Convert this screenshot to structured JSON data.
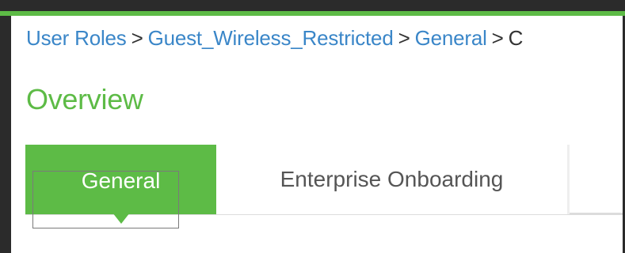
{
  "breadcrumb": {
    "items": [
      {
        "label": "User Roles"
      },
      {
        "label": "Guest_Wireless_Restricted"
      },
      {
        "label": "General"
      }
    ],
    "separator": ">",
    "current_fragment": "C"
  },
  "page": {
    "title": "Overview"
  },
  "tabs": [
    {
      "label": "General",
      "active": true
    },
    {
      "label": "Enterprise Onboarding",
      "active": false
    }
  ],
  "colors": {
    "accent_green": "#5dbb46",
    "link_blue": "#3a86c8",
    "frame_dark": "#2b2b2b"
  }
}
